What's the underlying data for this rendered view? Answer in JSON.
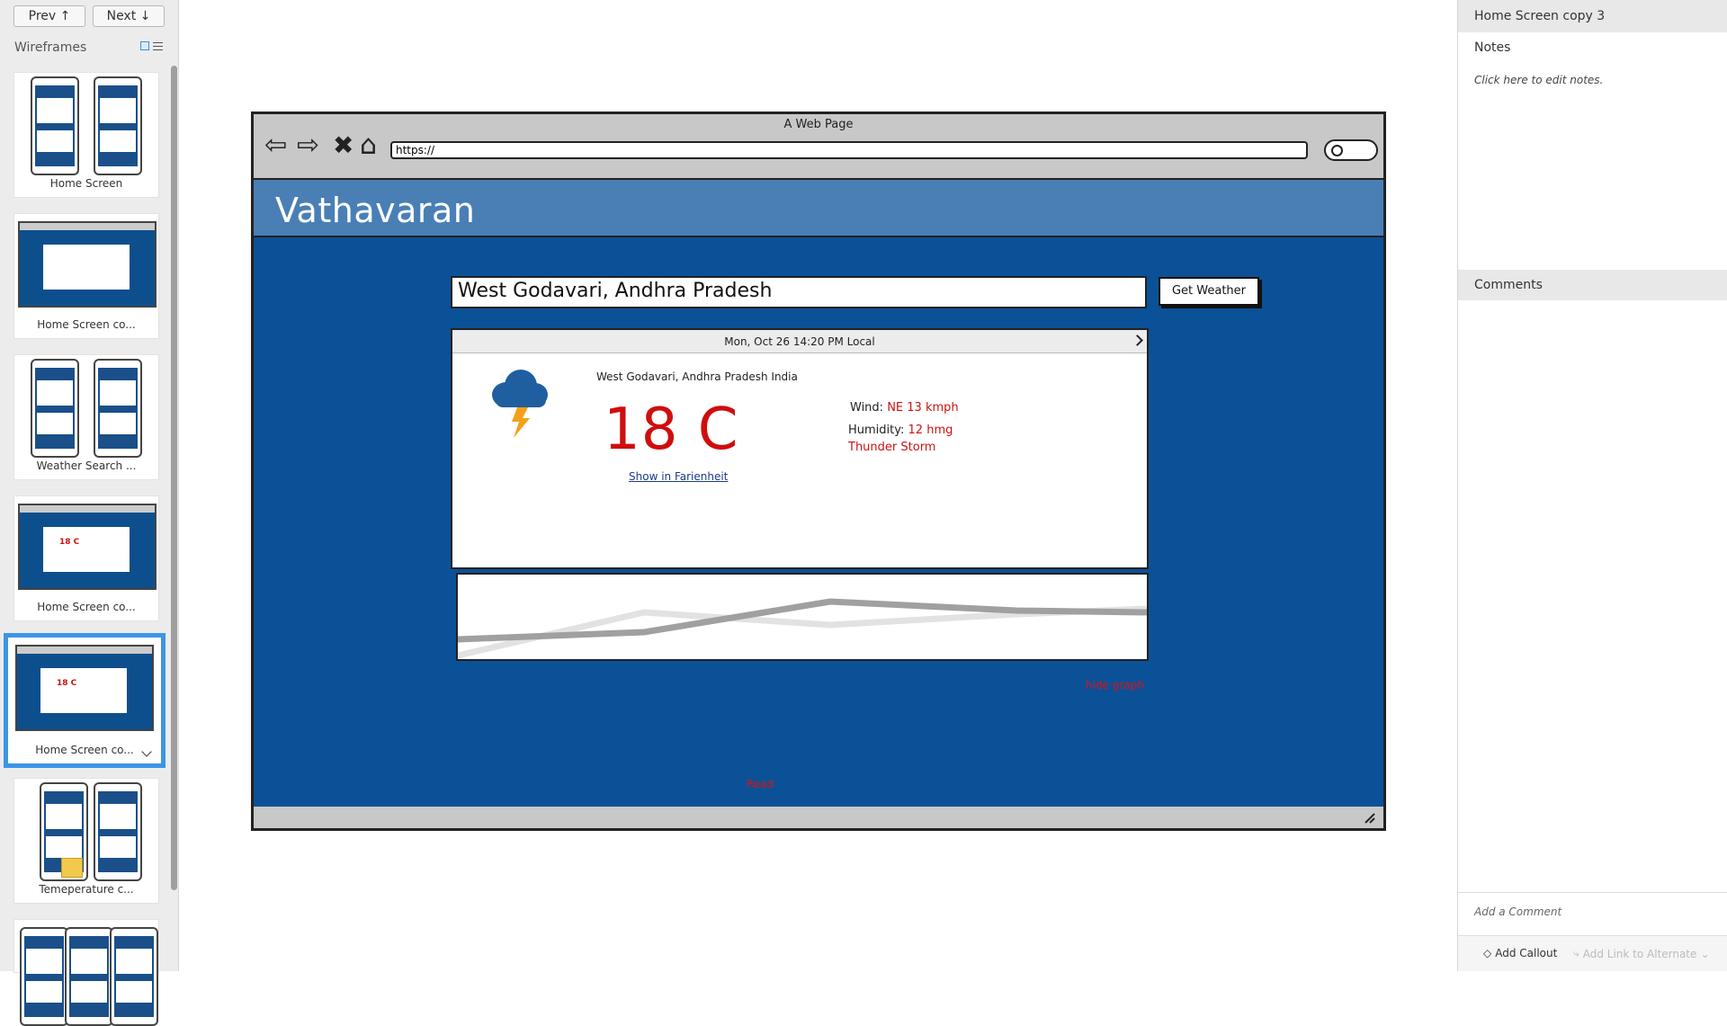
{
  "left_panel": {
    "prev_label": "Prev ↑",
    "next_label": "Next ↓",
    "heading": "Wireframes",
    "thumbnails": [
      {
        "label": "Home Screen"
      },
      {
        "label": "Home Screen co..."
      },
      {
        "label": "Weather Search ..."
      },
      {
        "label": "Home Screen co..."
      },
      {
        "label": "Home Screen co..."
      },
      {
        "label": "Temeperature c..."
      }
    ],
    "mini_temp": "18 C"
  },
  "browser": {
    "title": "A Web Page",
    "url": "https://"
  },
  "site": {
    "title": "Vathavaran",
    "location_input": "West Godavari, Andhra Pradesh",
    "get_weather_label": "Get Weather",
    "card": {
      "datetime": "Mon, Oct 26 14:20 PM Local",
      "location": "West Godavari, Andhra Pradesh  India",
      "temperature": "18 C",
      "fahrenheit_link": "Show in Farienheit",
      "wind_label": "Wind:",
      "wind_value": "NE 13 kmph",
      "humidity_label": "Humidity:",
      "humidity_value": "12 hmg",
      "condition": "Thunder Storm"
    },
    "hide_graph_label": "hide graph",
    "read_label": "Read"
  },
  "right_panel": {
    "screen_title": "Home Screen copy 3",
    "notes_heading": "Notes",
    "notes_placeholder": "Click here to edit notes.",
    "comments_heading": "Comments",
    "comment_placeholder": "Add a Comment",
    "add_callout_label": "Add Callout",
    "add_link_label": "Add Link to Alternate"
  },
  "colors": {
    "site_bg": "#0b5197",
    "header_bg": "#4a7fb5",
    "accent_red": "#d00d0d",
    "selection_blue": "#3d95e6"
  }
}
